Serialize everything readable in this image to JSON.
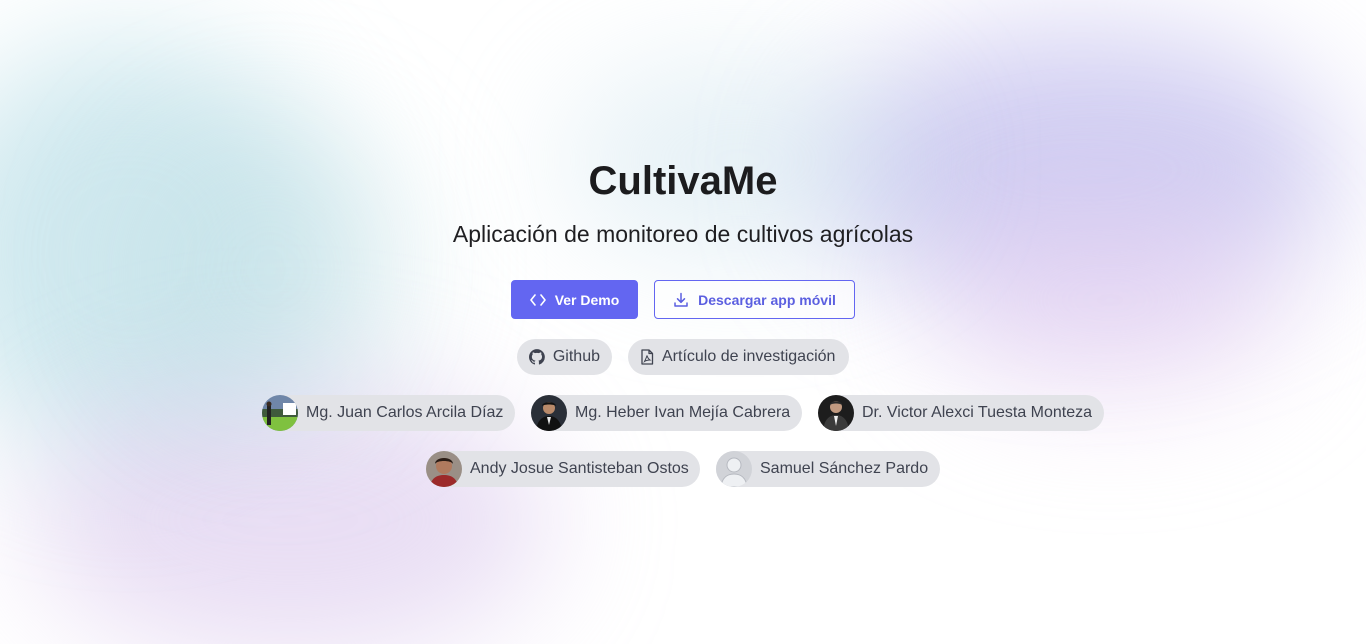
{
  "hero": {
    "title": "CultivaMe",
    "subtitle": "Aplicación de monitoreo de cultivos agrícolas"
  },
  "actions": {
    "demo_label": "Ver Demo",
    "download_label": "Descargar app móvil",
    "demo_icon": "code-icon",
    "download_icon": "download-icon"
  },
  "links": {
    "github_label": "Github",
    "github_icon": "github-icon",
    "paper_label": "Artículo de investigación",
    "paper_icon": "pdf-file-icon"
  },
  "authors": [
    {
      "name": "Mg. Juan Carlos Arcila Díaz"
    },
    {
      "name": "Mg. Heber Ivan Mejía Cabrera"
    },
    {
      "name": "Dr. Victor Alexci Tuesta Monteza"
    },
    {
      "name": "Andy Josue Santisteban Ostos"
    },
    {
      "name": "Samuel Sánchez Pardo"
    }
  ],
  "colors": {
    "accent": "#6366f1",
    "chip_bg": "#e2e3e7",
    "chip_text": "#3f4350"
  }
}
